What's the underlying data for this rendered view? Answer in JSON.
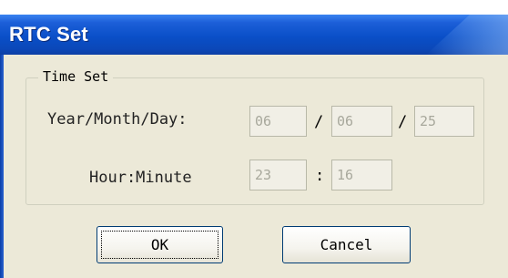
{
  "window": {
    "title": "RTC Set"
  },
  "group": {
    "legend": "Time Set"
  },
  "date": {
    "label": "Year/Month/Day:",
    "separator": "/",
    "year": "06",
    "month": "06",
    "day": "25"
  },
  "time": {
    "label": "Hour:Minute",
    "separator": ":",
    "hour": "23",
    "minute": "16"
  },
  "buttons": {
    "ok": "OK",
    "cancel": "Cancel"
  }
}
